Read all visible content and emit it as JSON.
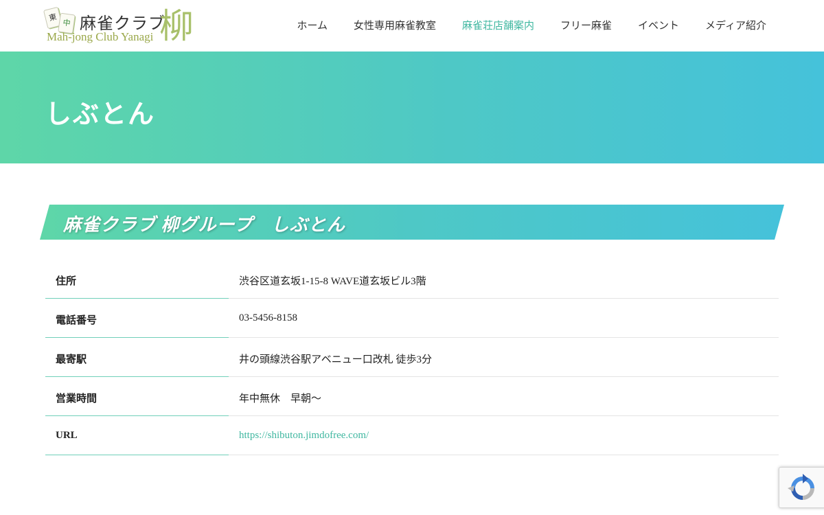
{
  "logo": {
    "tile1": "東",
    "tile2": "中",
    "title_jp": "麻雀クラブ",
    "title_en": "Mah-jong Club Yanagi",
    "kanji": "柳"
  },
  "nav": {
    "items": [
      {
        "label": "ホーム"
      },
      {
        "label": "女性専用麻雀教室"
      },
      {
        "label": "麻雀荘店舗案内",
        "active": true
      },
      {
        "label": "フリー麻雀"
      },
      {
        "label": "イベント"
      },
      {
        "label": "メディア紹介"
      }
    ]
  },
  "hero": {
    "title": "しぶとん"
  },
  "section": {
    "title": "麻雀クラブ 柳グループ　しぶとん"
  },
  "info": {
    "rows": [
      {
        "label": "住所",
        "value": "渋谷区道玄坂1-15-8 WAVE道玄坂ビル3階"
      },
      {
        "label": "電話番号",
        "value": "03-5456-8158"
      },
      {
        "label": "最寄駅",
        "value": "井の頭線渋谷駅アベニュー口改札 徒歩3分"
      },
      {
        "label": "営業時間",
        "value": "年中無休　早朝〜"
      },
      {
        "label": "URL",
        "value": "https://shibuton.jimdofree.com/"
      }
    ]
  },
  "colors": {
    "accent": "#3fb7a0",
    "gradient_start": "#5ed6a8",
    "gradient_end": "#45c2da"
  },
  "recaptcha": {
    "icon": "recaptcha-icon"
  }
}
